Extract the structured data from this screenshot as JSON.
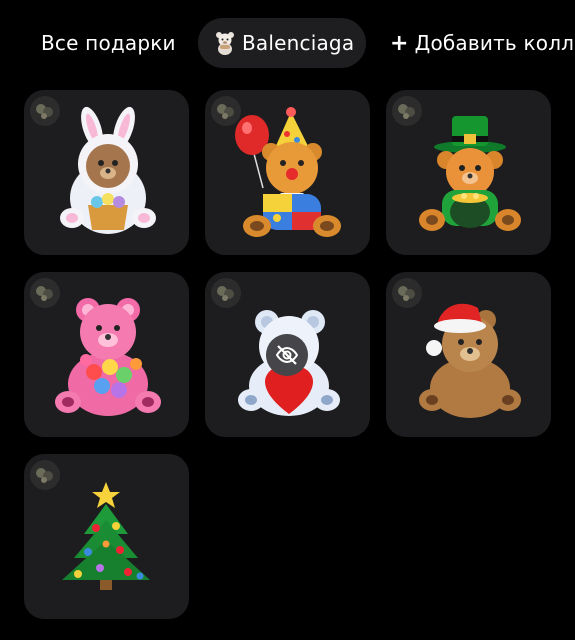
{
  "tabs": {
    "all": "Все подарки",
    "collection": "Balenciaga",
    "add": "Добавить колле",
    "add_icon": "plus-icon",
    "collection_icon": "bear-icon"
  },
  "gifts": [
    {
      "name": "bunny-bear",
      "icon": "bunny-bear-icon"
    },
    {
      "name": "clown-bear",
      "icon": "clown-bear-icon"
    },
    {
      "name": "leprechaun-bear",
      "icon": "leprechaun-bear-icon"
    },
    {
      "name": "flower-bear",
      "icon": "flower-bear-icon"
    },
    {
      "name": "heart-bear",
      "icon": "heart-bear-icon",
      "hidden_icon": "eye-slash-icon"
    },
    {
      "name": "santa-hat-bear",
      "icon": "santa-hat-bear-icon"
    },
    {
      "name": "christmas-tree",
      "icon": "christmas-tree-icon"
    }
  ],
  "colors": {
    "background": "#000000",
    "card": "#1d1d1f",
    "pill": "#1e1e20"
  }
}
